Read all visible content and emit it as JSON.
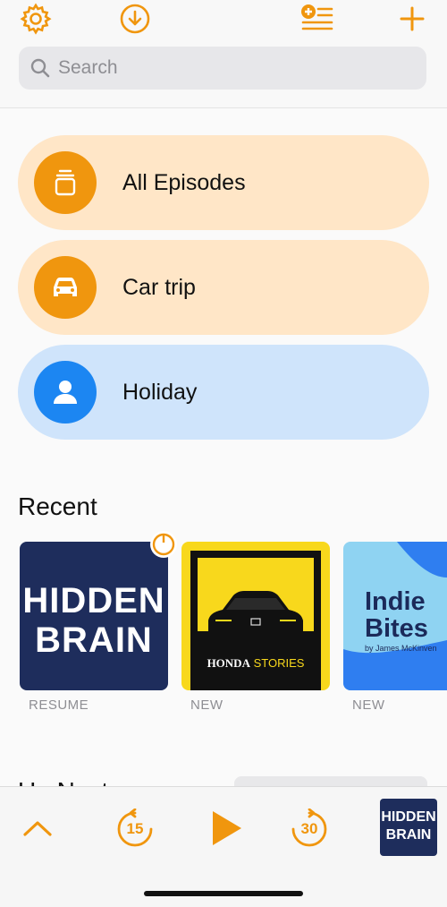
{
  "colors": {
    "accent": "#f0960e",
    "blue": "#1c86f2",
    "peach": "#ffe6c7",
    "lightblue": "#cfe4fb"
  },
  "toolbar": {
    "settings_icon": "gear-icon",
    "downloads_icon": "download-icon",
    "queue_icon": "add-to-queue-icon",
    "add_icon": "plus-icon"
  },
  "search": {
    "placeholder": "Search"
  },
  "filters": [
    {
      "label": "All Episodes",
      "icon": "episodes-stack-icon"
    },
    {
      "label": "Car trip",
      "icon": "car-icon"
    },
    {
      "label": "Holiday",
      "icon": "person-icon"
    }
  ],
  "recent": {
    "title": "Recent",
    "items": [
      {
        "status": "RESUME",
        "art_line1": "HIDDEN",
        "art_line2": "BRAIN"
      },
      {
        "status": "NEW",
        "art_text_bold": "HONDA",
        "art_text_light": "STORIES"
      },
      {
        "status": "NEW",
        "art_line1": "Indie",
        "art_line2": "Bites",
        "art_byline": "by James McKinven"
      }
    ]
  },
  "next_section": {
    "title": "Up Next"
  },
  "player": {
    "skip_back_seconds": "15",
    "skip_forward_seconds": "30",
    "artwork_line1": "HIDDEN",
    "artwork_line2": "BRAIN"
  }
}
